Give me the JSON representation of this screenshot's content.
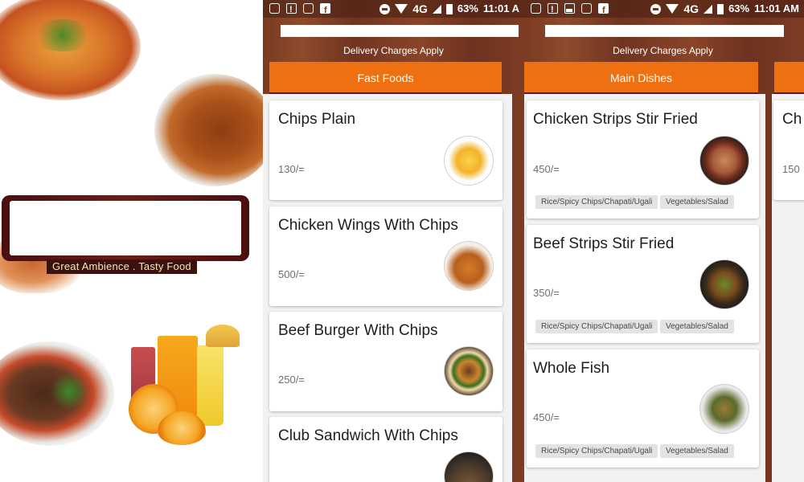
{
  "splash": {
    "tagline": "Great Ambience . Tasty Food"
  },
  "status_bar": {
    "network": "4G",
    "battery": "63%",
    "time_left": "11:01 A",
    "time_right": "11:01 AM"
  },
  "delivery_text": "Delivery Charges Apply",
  "screen1": {
    "category": "Fast Foods",
    "items": [
      {
        "title": "Chips Plain",
        "price": "130/=",
        "icon": "fries-icon"
      },
      {
        "title": "Chicken Wings With Chips",
        "price": "500/=",
        "icon": "wings-icon"
      },
      {
        "title": "Beef Burger With Chips",
        "price": "250/=",
        "icon": "burger-icon"
      },
      {
        "title": "Club Sandwich With Chips",
        "price": "",
        "icon": "sandwich-icon"
      }
    ]
  },
  "screen2": {
    "category": "Main Dishes",
    "items": [
      {
        "title": "Chicken Strips Stir Fried",
        "price": "450/=",
        "tags": [
          "Rice/Spicy Chips/Chapati/Ugali",
          "Vegetables/Salad"
        ]
      },
      {
        "title": "Beef Strips Stir Fried",
        "price": "350/=",
        "tags": [
          "Rice/Spicy Chips/Chapati/Ugali",
          "Vegetables/Salad"
        ]
      },
      {
        "title": "Whole Fish",
        "price": "450/=",
        "tags": [
          "Rice/Spicy Chips/Chapati/Ugali",
          "Vegetables/Salad"
        ]
      }
    ],
    "peek_card": {
      "title": "Ch",
      "price": "150"
    }
  },
  "colors": {
    "accent": "#ef7010",
    "header_brown": "#7a3b22",
    "tag_bg": "#e3e3e3"
  }
}
